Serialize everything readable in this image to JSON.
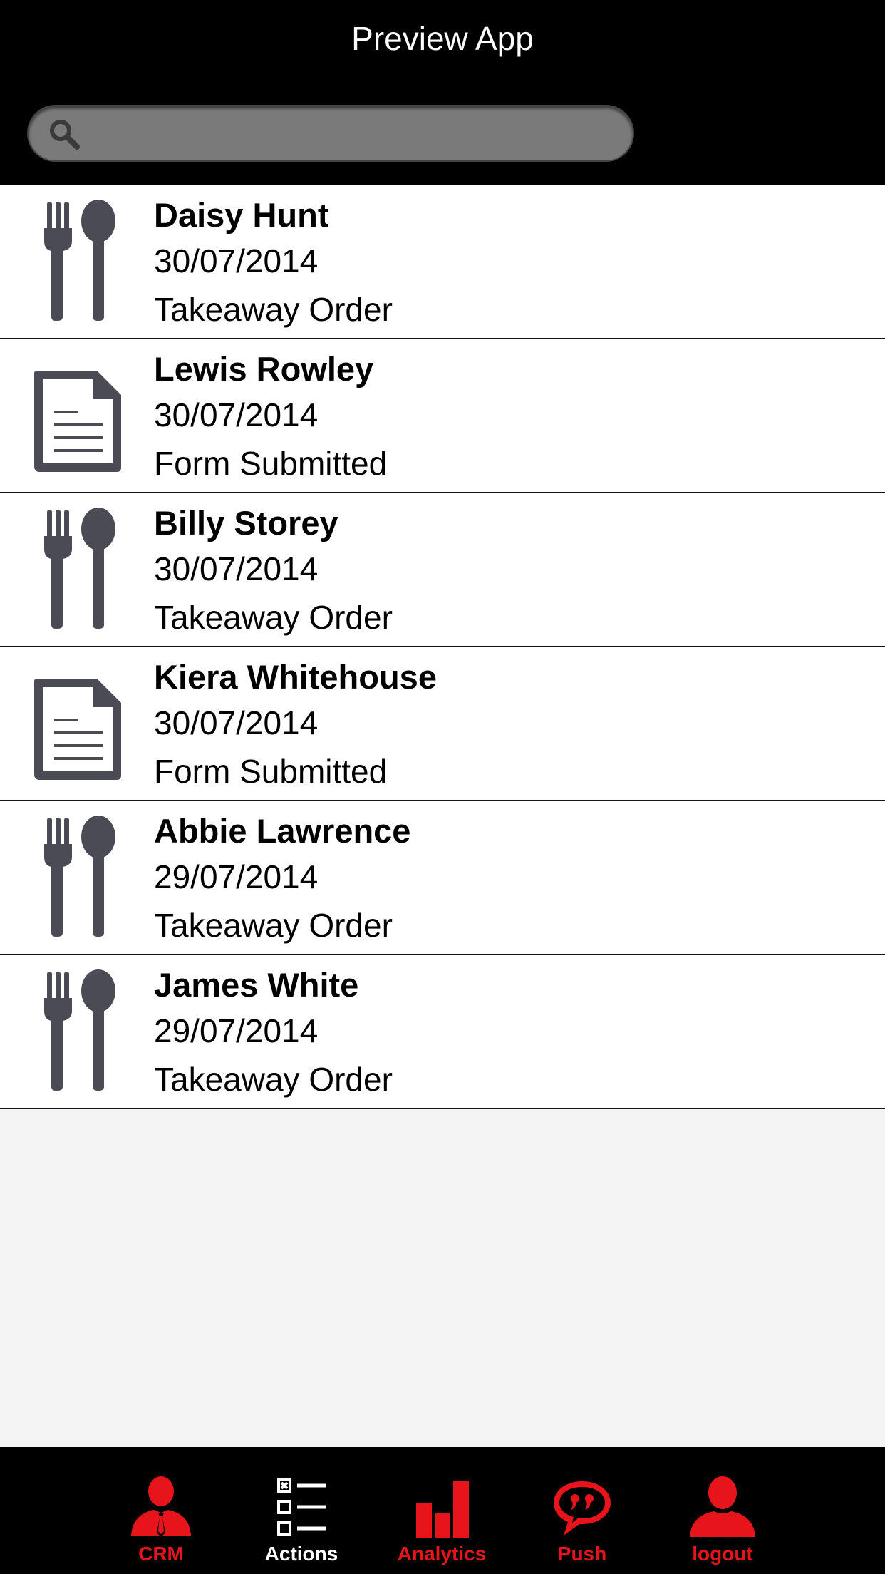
{
  "header": {
    "title": "Preview App"
  },
  "search": {
    "placeholder": "",
    "value": ""
  },
  "items": [
    {
      "name": "Daisy Hunt",
      "date": "30/07/2014",
      "type": "Takeaway Order",
      "icon": "cutlery-icon"
    },
    {
      "name": "Lewis Rowley",
      "date": "30/07/2014",
      "type": "Form Submitted",
      "icon": "document-icon"
    },
    {
      "name": "Billy Storey",
      "date": "30/07/2014",
      "type": "Takeaway Order",
      "icon": "cutlery-icon"
    },
    {
      "name": "Kiera Whitehouse",
      "date": "30/07/2014",
      "type": "Form Submitted",
      "icon": "document-icon"
    },
    {
      "name": "Abbie Lawrence",
      "date": "29/07/2014",
      "type": "Takeaway Order",
      "icon": "cutlery-icon"
    },
    {
      "name": "James White",
      "date": "29/07/2014",
      "type": "Takeaway Order",
      "icon": "cutlery-icon"
    }
  ],
  "tabbar": {
    "tabs": [
      {
        "label": "CRM",
        "icon": "person-tie-icon",
        "active": false
      },
      {
        "label": "Actions",
        "icon": "checklist-icon",
        "active": true
      },
      {
        "label": "Analytics",
        "icon": "bar-chart-icon",
        "active": false
      },
      {
        "label": "Push",
        "icon": "speech-bubble-icon",
        "active": false
      },
      {
        "label": "logout",
        "icon": "user-icon",
        "active": false
      }
    ]
  },
  "colors": {
    "accent": "#e8141c",
    "active_tab": "#ffffff",
    "icon_gray": "#4a4b55"
  }
}
